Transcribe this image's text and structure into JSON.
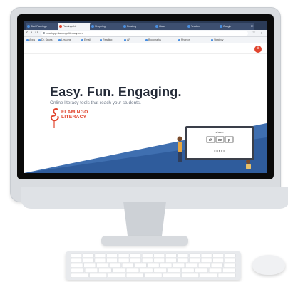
{
  "browser": {
    "tabs": [
      {
        "label": "Start Flamingo"
      },
      {
        "label": "Flamingo Lit"
      },
      {
        "label": "Shopping"
      },
      {
        "label": "Reading"
      },
      {
        "label": "Class"
      },
      {
        "label": "Teacher"
      },
      {
        "label": "Google"
      }
    ],
    "address": "readinpp.flamingoliteracy.com",
    "bookmarks": [
      "Apps",
      "Dr. Seuss",
      "Lessons",
      "Email",
      "Reading",
      "AR",
      "Bookmarks",
      "Phonics",
      "Strategy"
    ]
  },
  "site": {
    "avatar_letter": "A",
    "headline": "Easy. Fun. Engaging.",
    "tagline": "Online literacy tools that reach your students.",
    "logo_line1": "FLAMINGO",
    "logo_line2": "LITERACY",
    "word_tiles": [
      "sh",
      "ee",
      "p"
    ],
    "word_under": "sheep",
    "word_small": "c h e e p"
  },
  "colors": {
    "brand": "#e1452e",
    "tabbar": "#2b3b57",
    "headline": "#232a37",
    "band": "#3f6fb0"
  }
}
